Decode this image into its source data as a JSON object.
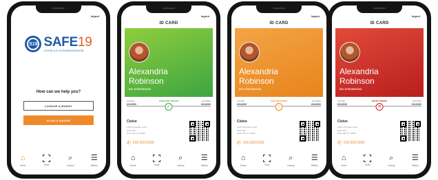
{
  "common": {
    "logout": "logout",
    "nav": [
      {
        "label": "Home",
        "icon": "home-icon"
      },
      {
        "label": "Scan",
        "icon": "scan-icon"
      },
      {
        "label": "Lookup",
        "icon": "search-icon"
      },
      {
        "label": "History",
        "icon": "list-icon"
      }
    ]
  },
  "home": {
    "logo_badge": "S19",
    "logo_safe": "SAFE",
    "logo_num": "19",
    "logo_sub": "COVID-19 CLEARINGHOUSE",
    "question": "How can we help you?",
    "lookup_button": "LOOKUP A BUDDY",
    "scan_button": "SCAN A BADGE"
  },
  "id_cards": [
    {
      "title": "ID CARD",
      "status": "green",
      "status_text": "PASS AND TESTED",
      "status_symbol": "✓",
      "first_name": "Alexandria",
      "last_name": "Robinson",
      "id_number": "ID# 87984651543",
      "date_left_label": "ISSUED",
      "date_left": "6/11/2020",
      "date_right_label": "EXPIRES",
      "date_right": "6/11/2020",
      "org": "Cisive",
      "address": [
        "1000 Corporate Court",
        "Suite 300",
        "Rock Hill, NY 12000"
      ],
      "phone": "516.629.0150",
      "accent": "#3ca541"
    },
    {
      "title": "ID CARD",
      "status": "orange",
      "status_text": "TEST REQUIRED",
      "status_symbol": "!",
      "first_name": "Alexandria",
      "last_name": "Robinson",
      "id_number": "ID# 87984651543",
      "date_left_label": "ISSUED",
      "date_left": "6/11/2020",
      "date_right_label": "EXPIRES",
      "date_right": "6/11/2020",
      "org": "Cisive",
      "address": [
        "1000 Corporate Court",
        "Suite 300",
        "Rock Hill, NY 12000"
      ],
      "phone": "516.629.0150",
      "accent": "#e7841c"
    },
    {
      "title": "ID CARD",
      "status": "red",
      "status_text": "ENTRY DENIED",
      "status_symbol": "✕",
      "first_name": "Alexandria",
      "last_name": "Robinson",
      "id_number": "ID# 87984651543",
      "date_left_label": "ISSUED",
      "date_left": "6/11/2020",
      "date_right_label": "EXPIRES",
      "date_right": "6/11/2020",
      "org": "Cisive",
      "address": [
        "1000 Corporate Court",
        "Suite 300",
        "Rock Hill, NY 12000"
      ],
      "phone": "516.629.0150",
      "accent": "#c72222"
    }
  ]
}
